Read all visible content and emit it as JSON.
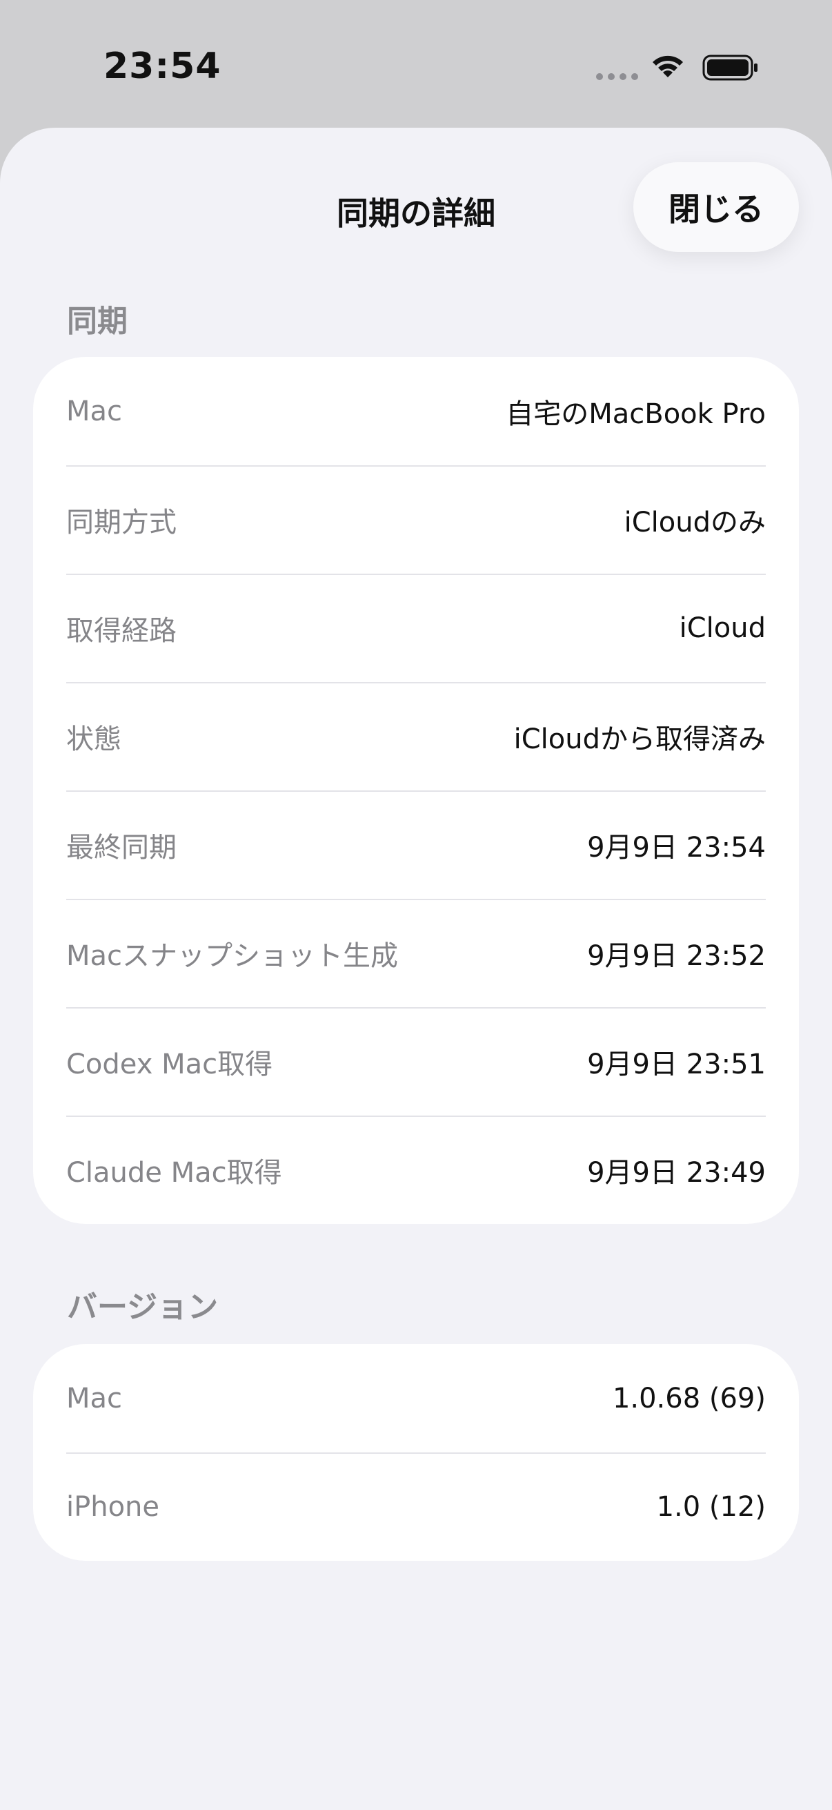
{
  "status_bar": {
    "time": "23:54"
  },
  "header": {
    "title": "同期の詳細",
    "close_label": "閉じる"
  },
  "sections": {
    "sync": {
      "title": "同期",
      "rows": [
        {
          "label": "Mac",
          "value": "自宅のMacBook Pro"
        },
        {
          "label": "同期方式",
          "value": "iCloudのみ"
        },
        {
          "label": "取得経路",
          "value": "iCloud"
        },
        {
          "label": "状態",
          "value": "iCloudから取得済み"
        },
        {
          "label": "最終同期",
          "value": "9月9日 23:54"
        },
        {
          "label": "Macスナップショット生成",
          "value": "9月9日 23:52"
        },
        {
          "label": "Codex Mac取得",
          "value": "9月9日 23:51"
        },
        {
          "label": "Claude Mac取得",
          "value": "9月9日 23:49"
        }
      ]
    },
    "version": {
      "title": "バージョン",
      "rows": [
        {
          "label": "Mac",
          "value": "1.0.68 (69)"
        },
        {
          "label": "iPhone",
          "value": "1.0 (12)"
        }
      ]
    }
  }
}
